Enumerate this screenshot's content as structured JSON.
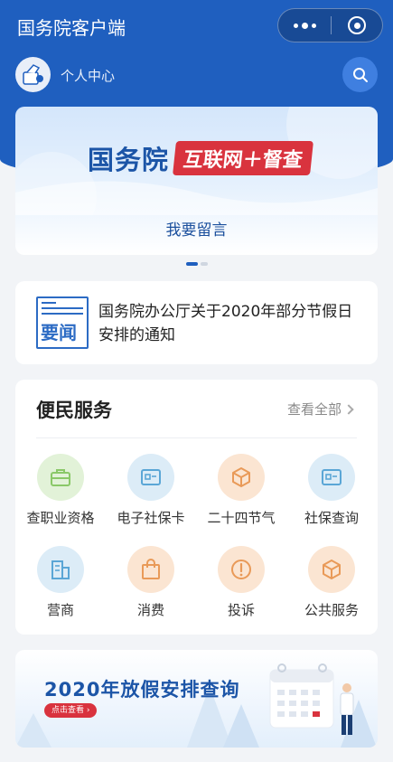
{
  "header": {
    "app_title": "国务院客户端",
    "user_label": "个人中心"
  },
  "banner": {
    "logo_main": "国务院",
    "logo_tag": "互联网＋督查",
    "cta": "我要留言",
    "slides_total": 2,
    "slide_active": 1
  },
  "news": {
    "icon_label": "要闻",
    "title": "国务院办公厅关于2020年部分节假日安排的通知"
  },
  "services": {
    "title": "便民服务",
    "view_all": "查看全部",
    "items": [
      {
        "label": "查职业资格",
        "icon": "briefcase-icon",
        "color": "#8ac868",
        "bg": "#e2f2d8"
      },
      {
        "label": "电子社保卡",
        "icon": "id-card-icon",
        "color": "#5aa6d6",
        "bg": "#dcecf7"
      },
      {
        "label": "二十四节气",
        "icon": "cube-icon",
        "color": "#e99a58",
        "bg": "#fbe5d2"
      },
      {
        "label": "社保查询",
        "icon": "id-card-icon",
        "color": "#5aa6d6",
        "bg": "#dcecf7"
      },
      {
        "label": "营商",
        "icon": "building-icon",
        "color": "#5aa6d6",
        "bg": "#dcecf7"
      },
      {
        "label": "消费",
        "icon": "shopping-bag-icon",
        "color": "#e99a58",
        "bg": "#fbe5d2"
      },
      {
        "label": "投诉",
        "icon": "alert-icon",
        "color": "#e99a58",
        "bg": "#fbe5d2"
      },
      {
        "label": "公共服务",
        "icon": "cube-icon",
        "color": "#e99a58",
        "bg": "#fbe5d2"
      }
    ]
  },
  "holiday_banner": {
    "title": "2020年放假安排查询",
    "button": "点击查看 ›"
  },
  "colors": {
    "brand_blue": "#1f5fbf",
    "accent_red": "#d9333e"
  }
}
